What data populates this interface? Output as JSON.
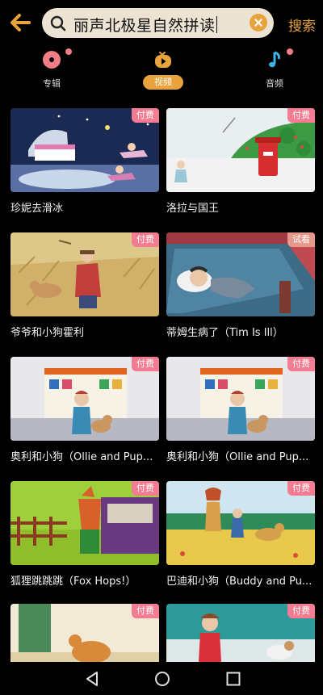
{
  "search": {
    "query": "丽声北极星自然拼读",
    "button_label": "搜索"
  },
  "tabs": [
    {
      "label": "专辑",
      "icon": "album-disc-icon",
      "badge_dot": true
    },
    {
      "label": "视频",
      "icon": "video-play-icon",
      "active": true
    },
    {
      "label": "音频",
      "icon": "music-note-icon",
      "badge_dot": true
    }
  ],
  "videos": [
    {
      "title": "珍妮去滑冰",
      "badge": "付费"
    },
    {
      "title": "洛拉与国王",
      "badge": "付费"
    },
    {
      "title": "爷爷和小狗霍利",
      "badge": "付费"
    },
    {
      "title": "蒂姆生病了（Tim Is Ill）",
      "badge": "试看"
    },
    {
      "title": "奥利和小狗（Ollie and Pup...",
      "badge": "付费"
    },
    {
      "title": "奥利和小狗（Ollie and Pup...",
      "badge": "付费"
    },
    {
      "title": "狐狸跳跳跳（Fox Hops!）",
      "badge": "付费"
    },
    {
      "title": "巴迪和小狗（Buddy and Pu...",
      "badge": "付费"
    },
    {
      "title": "",
      "badge": "付费"
    },
    {
      "title": "",
      "badge": "付费"
    }
  ],
  "colors": {
    "accent": "#e8a33d",
    "paid_badge": "#f47c92",
    "trial_badge": "#e6998a"
  }
}
